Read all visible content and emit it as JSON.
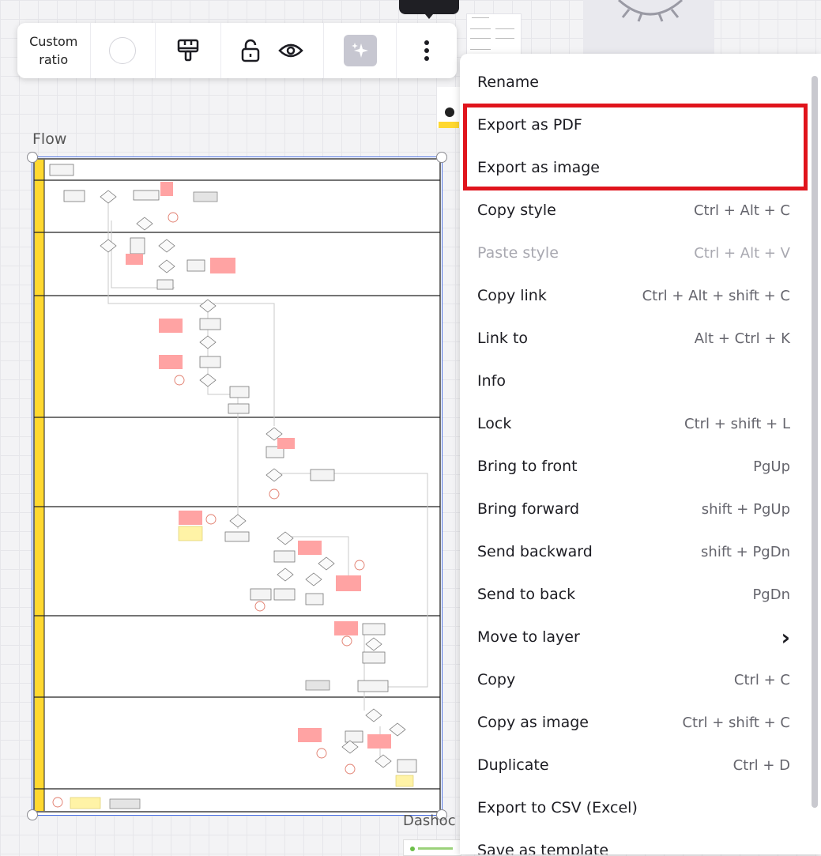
{
  "toolbar": {
    "ratio_line1": "Custom",
    "ratio_line2": "ratio",
    "color_button": "color-picker",
    "icons": [
      "paint-brush-icon",
      "unlock-icon",
      "eye-icon",
      "sparkle-icon",
      "more-vertical-icon"
    ]
  },
  "canvas": {
    "frame_title": "Flow",
    "second_frame_title": "Dashoc"
  },
  "menu": {
    "items": [
      {
        "label": "Rename",
        "shortcut": ""
      },
      {
        "label": "Export as PDF",
        "shortcut": ""
      },
      {
        "label": "Export as image",
        "shortcut": ""
      },
      {
        "label": "Copy style",
        "shortcut": "Ctrl + Alt + C"
      },
      {
        "label": "Paste style",
        "shortcut": "Ctrl + Alt + V",
        "disabled": true
      },
      {
        "label": "Copy link",
        "shortcut": "Ctrl + Alt + shift + C"
      },
      {
        "label": "Link to",
        "shortcut": "Alt + Ctrl + K"
      },
      {
        "label": "Info",
        "shortcut": ""
      },
      {
        "label": "Lock",
        "shortcut": "Ctrl + shift + L"
      },
      {
        "label": "Bring to front",
        "shortcut": "PgUp"
      },
      {
        "label": "Bring forward",
        "shortcut": "shift + PgUp"
      },
      {
        "label": "Send backward",
        "shortcut": "shift + PgDn"
      },
      {
        "label": "Send to back",
        "shortcut": "PgDn"
      },
      {
        "label": "Move to layer",
        "shortcut": "›"
      },
      {
        "label": "Copy",
        "shortcut": "Ctrl + C"
      },
      {
        "label": "Copy as image",
        "shortcut": "Ctrl + shift + C"
      },
      {
        "label": "Duplicate",
        "shortcut": "Ctrl + D"
      },
      {
        "label": "Export to CSV (Excel)",
        "shortcut": ""
      },
      {
        "label": "Save as template",
        "shortcut": ""
      }
    ],
    "highlight_color": "#e0141c"
  },
  "colors": {
    "accent": "#4a6fe3",
    "lane_yellow": "#ffd830",
    "sticky_red": "#ffa3a3",
    "sticky_yellow": "#fff3a6"
  }
}
